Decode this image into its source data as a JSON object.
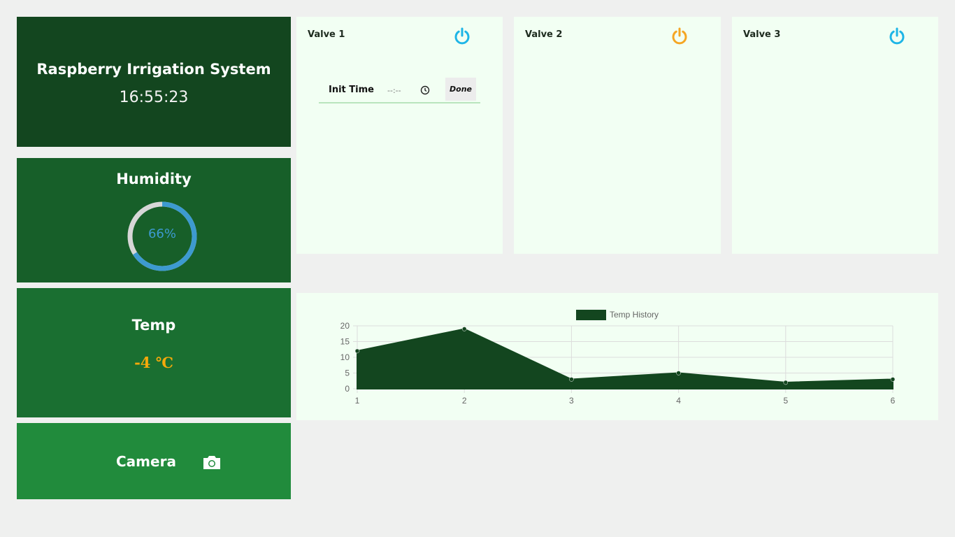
{
  "header": {
    "title": "Raspberry Irrigation System",
    "time": "16:55:23"
  },
  "humidity": {
    "title": "Humidity",
    "value_text": "66%",
    "value": 66
  },
  "temp": {
    "title": "Temp",
    "value_text": "-4 ℃"
  },
  "camera": {
    "label": "Camera",
    "icon": "camera-icon"
  },
  "valves": [
    {
      "name": "Valve 1",
      "power_color": "#1eb5e6",
      "init_label": "Init Time",
      "time_placeholder": "--:--",
      "done_label": "Done"
    },
    {
      "name": "Valve 2",
      "power_color": "#f5a623"
    },
    {
      "name": "Valve 3",
      "power_color": "#1eb5e6"
    }
  ],
  "colors": {
    "header_bg": "#13461f",
    "humidity_bg": "#175f29",
    "temp_bg": "#1a6f31",
    "camera_bg": "#218b3c",
    "panel_bg": "#f2fff3",
    "chart_fill": "#13461f"
  },
  "chart_data": {
    "type": "area",
    "legend": "Temp History",
    "legend_position": "top",
    "categories": [
      "1",
      "2",
      "3",
      "4",
      "5",
      "6"
    ],
    "series": [
      {
        "name": "Temp History",
        "values": [
          12,
          19,
          3,
          5,
          2,
          3
        ]
      }
    ],
    "ylim": [
      0,
      20
    ],
    "yticks": [
      "0",
      "5",
      "10",
      "15",
      "20"
    ],
    "grid": true
  }
}
